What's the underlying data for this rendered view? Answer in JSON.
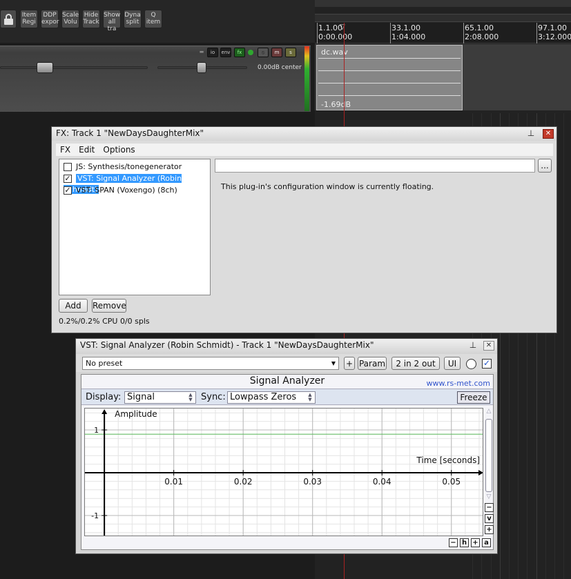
{
  "toolbar": {
    "buttons": [
      {
        "top": "Item",
        "bottom": "Regi"
      },
      {
        "top": "DDP",
        "bottom": "expor"
      },
      {
        "top": "Scale",
        "bottom": "Volu"
      },
      {
        "top": "Hide",
        "bottom": "Track"
      },
      {
        "top": "Show",
        "bottom": "all tra"
      },
      {
        "top": "Dyna",
        "bottom": "split"
      },
      {
        "top": "Q",
        "bottom": "item"
      }
    ]
  },
  "track": {
    "io_label": "io",
    "env_label": "env",
    "fx_label": "fx",
    "m_label": "m",
    "s_label": "s",
    "volume_readout": "0.00dB center"
  },
  "timeline": {
    "ruler": [
      {
        "bar": "1.1.00",
        "time": "0:00.000"
      },
      {
        "bar": "33.1.00",
        "time": "1:04.000"
      },
      {
        "bar": "65.1.00",
        "time": "2:08.000"
      },
      {
        "bar": "97.1.00",
        "time": "3:12.000"
      }
    ],
    "item_name": "dc.wav",
    "item_gain": "-1.69dB"
  },
  "fx_window": {
    "title": "FX: Track 1 \"NewDaysDaughterMix\"",
    "menu": [
      "FX",
      "Edit",
      "Options"
    ],
    "plugins": [
      {
        "name": "JS: Synthesis/tonegenerator",
        "checked": false,
        "selected": false
      },
      {
        "name": "VST: Signal Analyzer (Robin Schmidt)",
        "checked": true,
        "selected": true
      },
      {
        "name": "VST: SPAN (Voxengo) (8ch)",
        "checked": true,
        "selected": false
      }
    ],
    "path_button": "...",
    "floating_message": "This plug-in's configuration window is currently floating.",
    "add_label": "Add",
    "remove_label": "Remove",
    "cpu": "0.2%/0.2% CPU 0/0 spls"
  },
  "analyzer_window": {
    "title": "VST: Signal Analyzer (Robin Schmidt) - Track 1 \"NewDaysDaughterMix\"",
    "preset": "No preset",
    "plus_label": "+",
    "param_label": "Param",
    "io_label": "2 in 2 out",
    "ui_label": "UI",
    "heading": "Signal Analyzer",
    "url": "www.rs-met.com",
    "display_label": "Display:",
    "display_value": "Signal",
    "sync_label": "Sync:",
    "sync_value": "Lowpass Zeros",
    "freeze_label": "Freeze",
    "zoom_buttons": {
      "minus": "−",
      "v": "v",
      "plus": "+",
      "a": "a",
      "h": "h"
    }
  },
  "chart_data": {
    "type": "line",
    "ylabel": "Amplitude",
    "xlabel": "Time [seconds]",
    "x_ticks": [
      "0.01",
      "0.02",
      "0.03",
      "0.04",
      "0.05"
    ],
    "y_ticks": [
      "1",
      "-1"
    ],
    "xlim": [
      -0.0028,
      0.0547
    ],
    "ylim": [
      -1.5,
      1.5
    ],
    "series": [
      {
        "x": [
          -0.0028,
          0.0547
        ],
        "values": [
          0.9,
          0.9
        ],
        "color": "#66bb66"
      }
    ],
    "grid": true
  },
  "colors": {
    "accent": "#3399ff",
    "close": "#c23a2a",
    "cursor": "#aa2222",
    "fx_on": "#2fa82f",
    "url": "#3355cc"
  }
}
